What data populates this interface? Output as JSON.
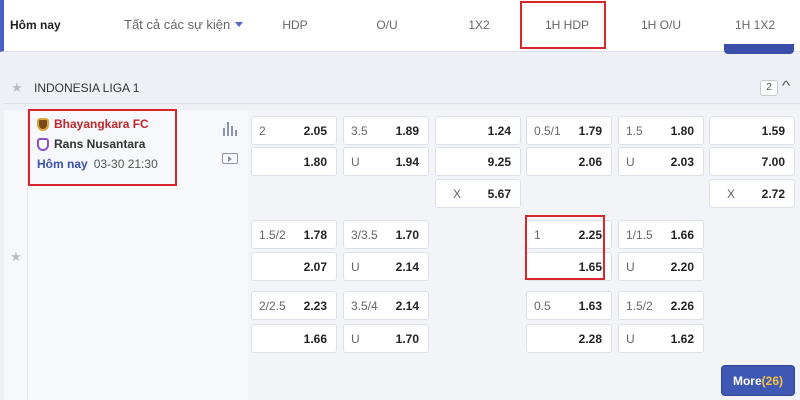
{
  "header": {
    "today_label": "Hôm nay",
    "filter_label": "Tất cả các sự kiện",
    "columns": [
      "HDP",
      "O/U",
      "1X2",
      "1H HDP",
      "1H O/U",
      "1H 1X2"
    ]
  },
  "league": {
    "name": "INDONESIA LIGA 1",
    "count": "2"
  },
  "match": {
    "home_team": "Bhayangkara FC",
    "away_team": "Rans Nusantara",
    "day": "Hôm nay",
    "datetime": "03-30 21:30"
  },
  "odds": {
    "r0": [
      {
        "h": "2",
        "o": "2.05"
      },
      {
        "h": "3.5",
        "o": "1.89"
      },
      {
        "h": "",
        "o": "1.24"
      },
      {
        "h": "0.5/1",
        "o": "1.79"
      },
      {
        "h": "1.5",
        "o": "1.80"
      },
      {
        "h": "",
        "o": "1.59"
      }
    ],
    "r1": [
      {
        "h": "",
        "o": "1.80"
      },
      {
        "h": "U",
        "o": "1.94"
      },
      {
        "h": "",
        "o": "9.25"
      },
      {
        "h": "",
        "o": "2.06"
      },
      {
        "h": "U",
        "o": "2.03"
      },
      {
        "h": "",
        "o": "7.00"
      }
    ],
    "r2": [
      {
        "h": "X",
        "o": "5.67"
      },
      {
        "h": "X",
        "o": "2.72"
      }
    ],
    "r3": [
      {
        "h": "1.5/2",
        "o": "1.78"
      },
      {
        "h": "3/3.5",
        "o": "1.70"
      },
      {
        "h": "1",
        "o": "2.25"
      },
      {
        "h": "1/1.5",
        "o": "1.66"
      }
    ],
    "r4": [
      {
        "h": "",
        "o": "2.07"
      },
      {
        "h": "U",
        "o": "2.14"
      },
      {
        "h": "",
        "o": "1.65"
      },
      {
        "h": "U",
        "o": "2.20"
      }
    ],
    "r5": [
      {
        "h": "2/2.5",
        "o": "2.23"
      },
      {
        "h": "3.5/4",
        "o": "2.14"
      },
      {
        "h": "0.5",
        "o": "1.63"
      },
      {
        "h": "1.5/2",
        "o": "2.26"
      }
    ],
    "r6": [
      {
        "h": "",
        "o": "1.66"
      },
      {
        "h": "U",
        "o": "1.70"
      },
      {
        "h": "",
        "o": "2.28"
      },
      {
        "h": "U",
        "o": "1.62"
      }
    ]
  },
  "more": {
    "label": "More",
    "count": "(26)"
  },
  "colors": {
    "accent": "#3f58b4",
    "highlight": "#d9262c",
    "home_team": "#c0272d"
  }
}
